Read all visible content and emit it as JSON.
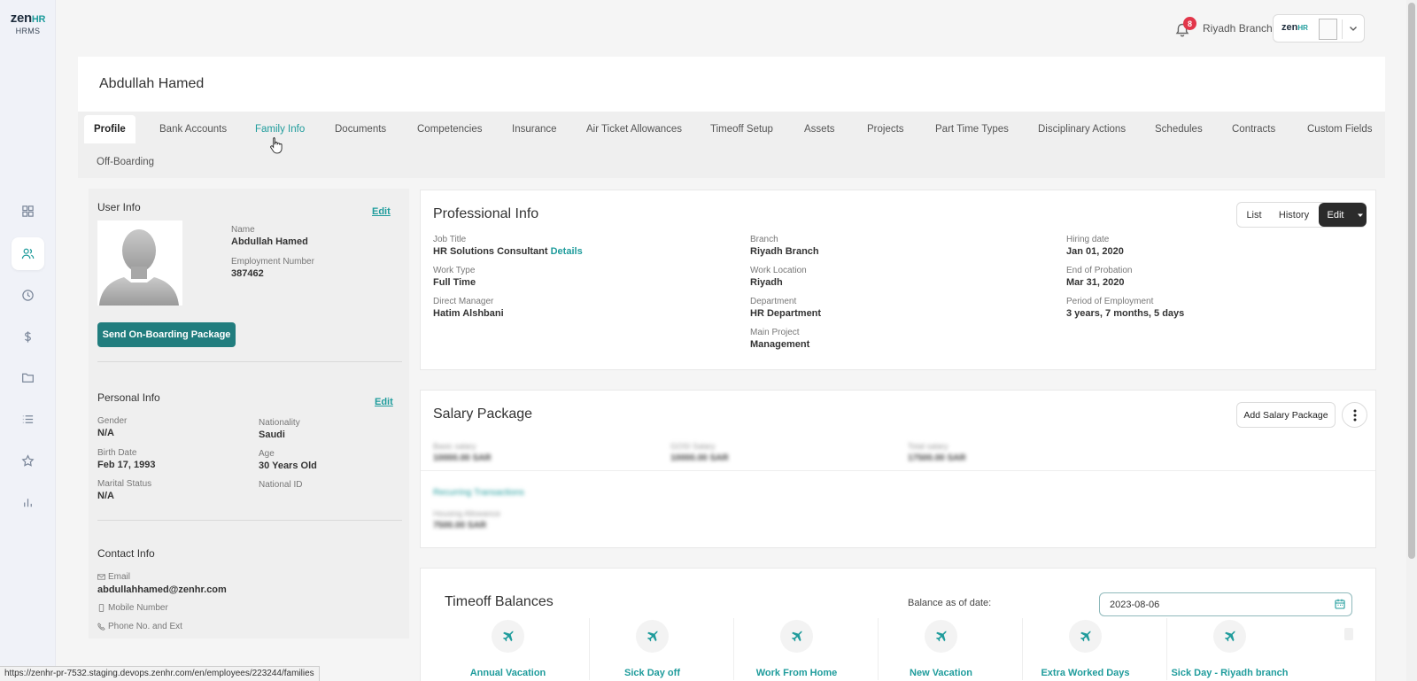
{
  "logo": {
    "brand_main": "zen",
    "brand_hr": "HR",
    "sub": "HRMS"
  },
  "sidebar": {
    "icons": [
      "dashboard-icon",
      "users-icon",
      "clock-icon",
      "dollar-icon",
      "folder-icon",
      "list-icon",
      "star-icon",
      "bar-chart-icon"
    ],
    "active": "users-icon"
  },
  "header": {
    "notification_count": "8",
    "branch": "Riyadh Branch",
    "account_logo_main": "zen",
    "account_logo_hr": "HR"
  },
  "profile": {
    "name": "Abdullah Hamed"
  },
  "tabs": [
    "Profile",
    "Bank Accounts",
    "Family Info",
    "Documents",
    "Competencies",
    "Insurance",
    "Air Ticket Allowances",
    "Timeoff Setup",
    "Assets",
    "Projects",
    "Part Time Types",
    "Disciplinary Actions",
    "Schedules",
    "Contracts",
    "Custom Fields",
    "Off-Boarding"
  ],
  "active_tab": "Profile",
  "user_info": {
    "title": "User Info",
    "edit": "Edit",
    "name_label": "Name",
    "name_value": "Abdullah Hamed",
    "employment_label": "Employment Number",
    "employment_value": "387462",
    "onboarding_button": "Send On-Boarding Package"
  },
  "personal_info": {
    "title": "Personal Info",
    "edit": "Edit",
    "gender_label": "Gender",
    "gender_value": "N/A",
    "nationality_label": "Nationality",
    "nationality_value": "Saudi",
    "birth_label": "Birth Date",
    "birth_value": "Feb 17, 1993",
    "age_label": "Age",
    "age_value": "30 Years Old",
    "marital_label": "Marital Status",
    "marital_value": "N/A",
    "national_id_label": "National ID"
  },
  "contact_info": {
    "title": "Contact Info",
    "email_label": "Email",
    "email_value": "abdullahhamed@zenhr.com",
    "mobile_label": "Mobile Number",
    "phone_label": "Phone No. and Ext"
  },
  "professional_info": {
    "title": "Professional Info",
    "buttons": {
      "list": "List",
      "history": "History",
      "edit": "Edit"
    },
    "job_title_label": "Job Title",
    "job_title_value": "HR Solutions Consultant",
    "details": "Details",
    "work_type_label": "Work Type",
    "work_type_value": "Full Time",
    "direct_manager_label": "Direct Manager",
    "direct_manager_value": "Hatim Alshbani",
    "branch_label": "Branch",
    "branch_value": "Riyadh Branch",
    "work_location_label": "Work Location",
    "work_location_value": "Riyadh",
    "department_label": "Department",
    "department_value": "HR Department",
    "main_project_label": "Main Project",
    "main_project_value": "Management",
    "hiring_label": "Hiring date",
    "hiring_value": "Jan 01, 2020",
    "probation_label": "End of Probation",
    "probation_value": "Mar 31, 2020",
    "period_label": "Period of Employment",
    "period_value": "3 years, 7 months, 5 days"
  },
  "salary_package": {
    "title": "Salary Package",
    "add_button": "Add Salary Package"
  },
  "timeoff": {
    "title": "Timeoff Balances",
    "balance_label": "Balance as of date:",
    "date_value": "2023-08-06",
    "items": [
      "Annual Vacation",
      "Sick Day off",
      "Work From Home",
      "New Vacation",
      "Extra Worked Days",
      "Sick Day - Riyadh branch"
    ]
  },
  "status_url": "https://zenhr-pr-7532.staging.devops.zenhr.com/en/employees/223244/families",
  "colors": {
    "accent": "#1f9c9c",
    "primary_button": "#217d7e",
    "badge": "#e2364a"
  }
}
